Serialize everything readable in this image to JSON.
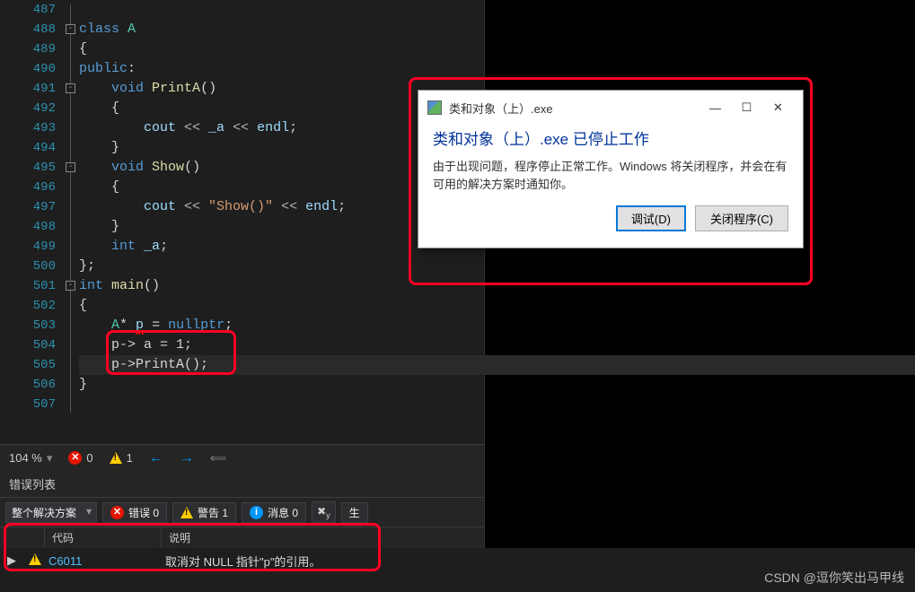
{
  "lines": [
    "487",
    "488",
    "489",
    "490",
    "491",
    "492",
    "493",
    "494",
    "495",
    "496",
    "497",
    "498",
    "499",
    "500",
    "501",
    "502",
    "503",
    "504",
    "505",
    "506",
    "507"
  ],
  "code": {
    "kw_class": "class",
    "class_name": "A",
    "brace_open": "{",
    "kw_public": "public",
    "colon": ":",
    "kw_void": "void",
    "fn_printa": "PrintA",
    "parens": "()",
    "cout": "cout",
    "op_ins": " << ",
    "mem_a": "_a",
    "endl": "endl",
    "semi": ";",
    "fn_show": "Show",
    "str_show": "\"Show()\"",
    "kw_int": "int",
    "decl_a": "_a",
    "brace_close": "}",
    "class_end": "};",
    "fn_main": "main",
    "ptr_decl_type": "A",
    "star": "* ",
    "var_p": "p",
    "eq": " = ",
    "nullptr": "nullptr",
    "l504": "p-> a = 1;",
    "l505": "p->PrintA();"
  },
  "status": {
    "zoom": "104 %",
    "errors": "0",
    "warnings": "1"
  },
  "errorlist": {
    "title": "错误列表",
    "scope": "整个解决方案",
    "btn_err": "错误 0",
    "btn_warn": "警告 1",
    "btn_msg": "消息 0",
    "btn_build": "生",
    "col_code": "代码",
    "col_desc": "说明",
    "row_code": "C6011",
    "row_desc": "取消对 NULL 指针\"p\"的引用。"
  },
  "dialog": {
    "title": "类和对象（上）.exe",
    "heading": "类和对象（上）.exe 已停止工作",
    "body": "由于出现问题，程序停止正常工作。Windows 将关闭程序，并会在有可用的解决方案时通知你。",
    "btn_debug": "调试(D)",
    "btn_close": "关闭程序(C)"
  },
  "watermark": "CSDN @逗你笑出马甲线"
}
